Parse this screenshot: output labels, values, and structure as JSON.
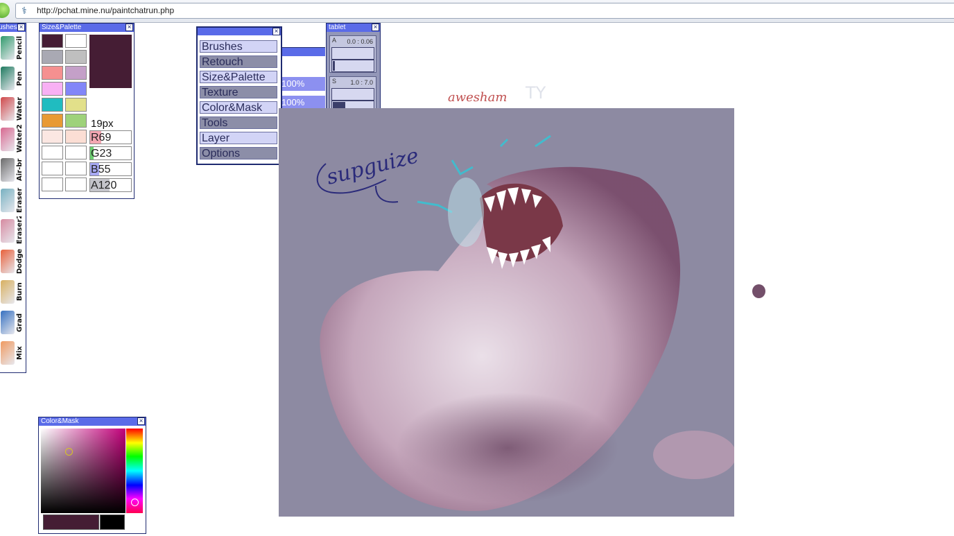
{
  "browser": {
    "url": "http://pchat.mine.nu/paintchatrun.php"
  },
  "brushes_palette": {
    "title": "Brushes",
    "tools": [
      {
        "label": "Pencil",
        "color": "#2f9a6b"
      },
      {
        "label": "Pen",
        "color": "#1e7a5e"
      },
      {
        "label": "Water",
        "color": "#d0484a"
      },
      {
        "label": "Water2",
        "color": "#d86890"
      },
      {
        "label": "Air-br",
        "color": "#6a6a6a"
      },
      {
        "label": "Eraser",
        "color": "#77b0c0"
      },
      {
        "label": "Eraser2",
        "color": "#d68aa0"
      },
      {
        "label": "Dodge",
        "color": "#e8603a"
      },
      {
        "label": "Burn",
        "color": "#d8b060"
      },
      {
        "label": "Grad",
        "color": "#3570c0"
      },
      {
        "label": "Mix",
        "color": "#f09a60"
      }
    ]
  },
  "size_palette": {
    "title": "Size&Palette",
    "swatches": [
      [
        "#451d34",
        "#ffffff"
      ],
      [
        "#a9a9b3",
        "#bfbfbf"
      ],
      [
        "#f59090",
        "#c4a0c8"
      ],
      [
        "#f8b0f4",
        "#8286f8"
      ],
      [
        "#20bcc0",
        "#e2e08a"
      ],
      [
        "#e89a34",
        "#9ed27a"
      ],
      [
        "#fbe7e2",
        "#fbded4"
      ],
      [
        "#ffffff",
        "#ffffff"
      ],
      [
        "#ffffff",
        "#ffffff"
      ],
      [
        "#ffffff",
        "#ffffff"
      ]
    ],
    "current_color": "#451d34",
    "size_label": "19px",
    "r_label": "R69",
    "g_label": "G23",
    "b_label": "B55",
    "a_label": "A120",
    "r": 69,
    "g": 23,
    "b": 55,
    "a": 120
  },
  "menu": {
    "items": [
      "Brushes",
      "Retouch",
      "Size&Palette",
      "Texture",
      "Color&Mask",
      "Tools",
      "Layer",
      "Options"
    ]
  },
  "layer_window": {
    "opacity1": "100%",
    "opacity2": "100%"
  },
  "tablet": {
    "title": "tablet",
    "a_label": "A",
    "a_range": "0.0 : 0.06",
    "s_label": "S",
    "s_range": "1.0 : 7.0"
  },
  "canvas": {
    "handwriting_bubble": "supguize",
    "signature": "awesham",
    "ty": "TY"
  },
  "color_mask": {
    "title": "Color&Mask",
    "current_color": "#451d34",
    "mask_color": "#000000"
  }
}
